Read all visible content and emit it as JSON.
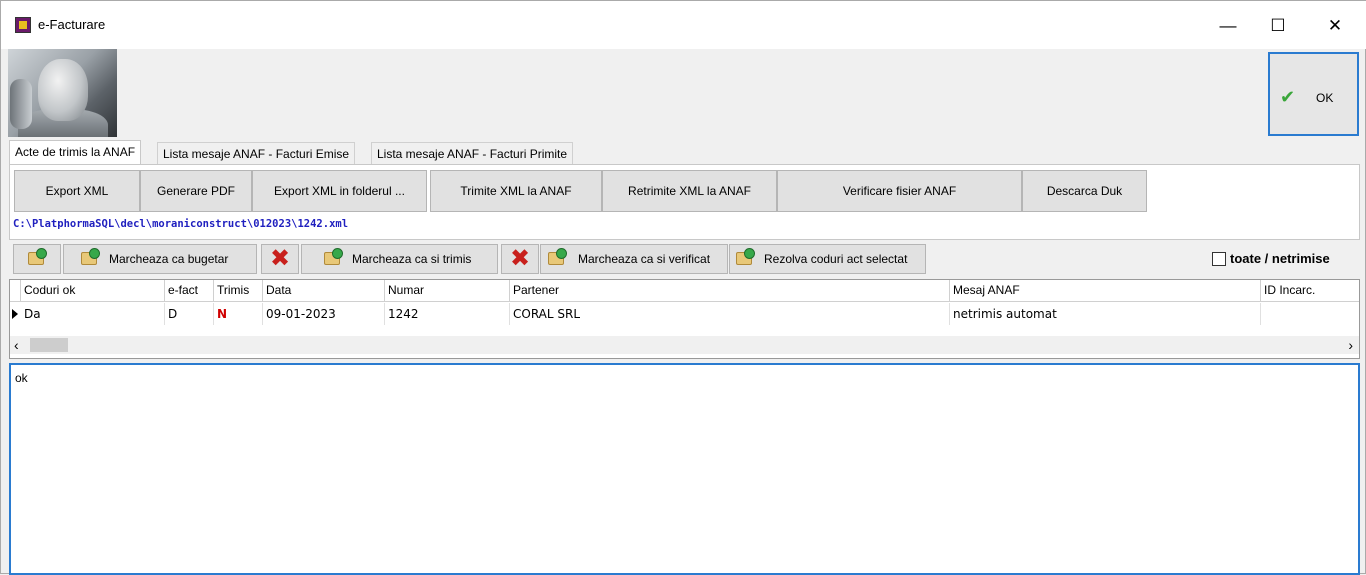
{
  "window": {
    "title": "e-Facturare",
    "minimize": "—",
    "maximize": "☐",
    "close": "✕"
  },
  "ok_button": {
    "label": "OK"
  },
  "tabs": [
    {
      "label": "Acte de trimis la ANAF",
      "active": true
    },
    {
      "label": "Lista mesaje ANAF - Facturi Emise",
      "active": false
    },
    {
      "label": "Lista mesaje ANAF - Facturi Primite",
      "active": false
    }
  ],
  "toolbar": {
    "export_xml": "Export XML",
    "generare_pdf": "Generare PDF",
    "export_folder": "Export XML in folderul ...",
    "trimite": "Trimite XML la ANAF",
    "retrimite": "Retrimite XML la ANAF",
    "verificare": "Verificare fisier ANAF",
    "descarca": "Descarca Duk"
  },
  "file_path": "C:\\PlatphormaSQL\\decl\\moraniconstruct\\012023\\1242.xml",
  "actions": {
    "bugetar": "Marcheaza ca bugetar",
    "trimis": "Marcheaza ca si trimis",
    "verificat": "Marcheaza ca si verificat",
    "rezolva": "Rezolva coduri act selectat",
    "toggle_label": "toate / netrimise"
  },
  "grid": {
    "columns": [
      "Coduri ok",
      "e-fact",
      "Trimis",
      "Data",
      "Numar",
      "Partener",
      "Mesaj ANAF",
      "ID Incarc."
    ],
    "rows": [
      {
        "coduri_ok": "Da",
        "e_fact": "D",
        "trimis": "N",
        "data": "09-01-2023",
        "numar": "1242",
        "partener": "CORAL SRL",
        "mesaj": "netrimis automat",
        "id_incarc": ""
      }
    ]
  },
  "memo": {
    "text": "ok"
  },
  "colors": {
    "accent": "#2a7bd0",
    "trimis_no": "#d00000",
    "path": "#1f1fbf"
  }
}
